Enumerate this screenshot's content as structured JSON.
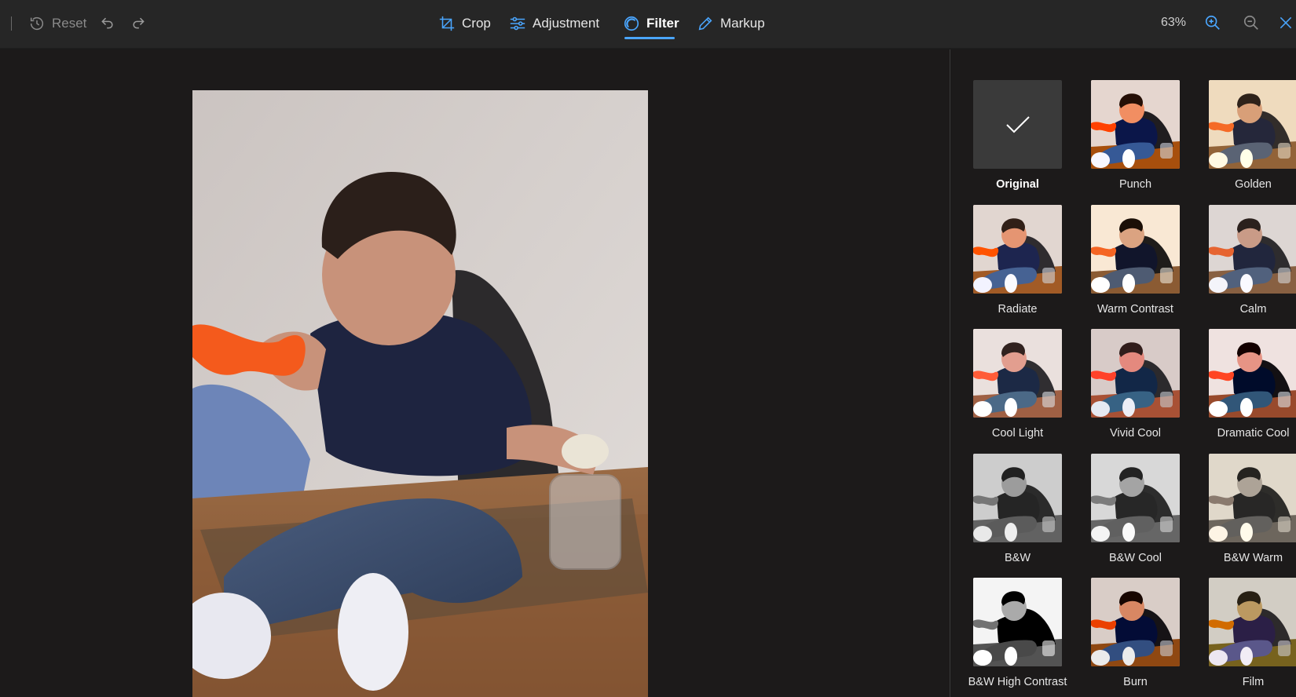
{
  "toolbar": {
    "reset_label": "Reset",
    "tabs": [
      {
        "label": "Crop",
        "icon": "crop-icon"
      },
      {
        "label": "Adjustment",
        "icon": "sliders-icon"
      },
      {
        "label": "Filter",
        "icon": "filter-icon",
        "active": true
      },
      {
        "label": "Markup",
        "icon": "pen-icon"
      }
    ],
    "zoom_level": "63%",
    "icons": [
      "history-icon",
      "undo-icon",
      "redo-icon",
      "zoom-in-icon",
      "zoom-out-icon",
      "close-icon"
    ]
  },
  "filters": {
    "selected": "Original",
    "items": [
      {
        "label": "Original"
      },
      {
        "label": "Punch"
      },
      {
        "label": "Golden"
      },
      {
        "label": "Radiate"
      },
      {
        "label": "Warm Contrast"
      },
      {
        "label": "Calm"
      },
      {
        "label": "Cool Light"
      },
      {
        "label": "Vivid Cool"
      },
      {
        "label": "Dramatic Cool"
      },
      {
        "label": "B&W"
      },
      {
        "label": "B&W Cool"
      },
      {
        "label": "B&W Warm"
      },
      {
        "label": "B&W High Contrast"
      },
      {
        "label": "Burn"
      },
      {
        "label": "Film"
      }
    ]
  },
  "colors": {
    "accent": "#4aa6ff",
    "toolbar_bg": "#262626",
    "canvas_bg": "#1c1a1a"
  }
}
